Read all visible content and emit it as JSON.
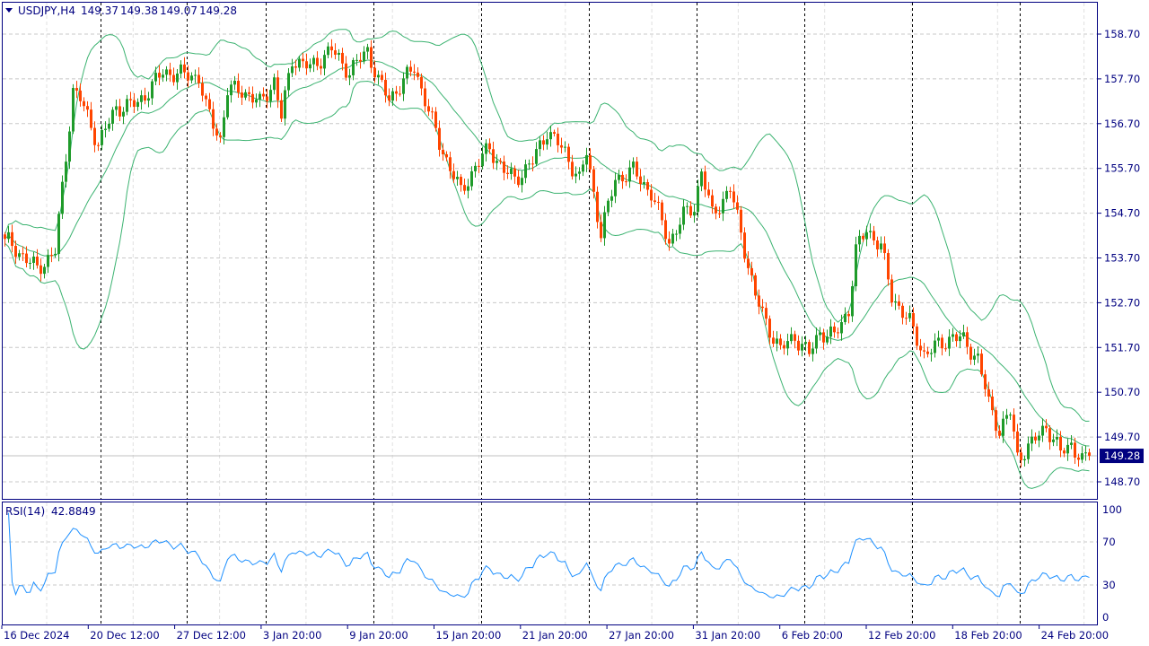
{
  "chart_data": {
    "type": "candlestick",
    "symbol_label": "USDJPY,H4",
    "header_ohlc": [
      "149.37",
      "149.38",
      "149.07",
      "149.28"
    ],
    "current_price": 149.28,
    "current_price_label": "149.28",
    "ylim": [
      148.34,
      159.42
    ],
    "yticks": [
      "158.70",
      "157.70",
      "156.70",
      "155.70",
      "154.70",
      "153.70",
      "152.70",
      "151.70",
      "150.70",
      "149.70",
      "148.70"
    ],
    "xticks": [
      "16 Dec 2024",
      "20 Dec 12:00",
      "27 Dec 12:00",
      "3 Jan 20:00",
      "9 Jan 20:00",
      "15 Jan 20:00",
      "21 Jan 20:00",
      "27 Jan 20:00",
      "31 Jan 20:00",
      "6 Feb 20:00",
      "12 Feb 20:00",
      "18 Feb 20:00",
      "24 Feb 20:00"
    ],
    "day_separators_bar_index": [
      27,
      51,
      73,
      103,
      133,
      163,
      193,
      223,
      253,
      283
    ],
    "key_closes": [
      [
        1,
        154.05
      ],
      [
        9,
        153.45
      ],
      [
        14,
        153.85
      ],
      [
        16,
        155.25
      ],
      [
        19,
        157.45
      ],
      [
        21,
        157.25
      ],
      [
        26,
        156.25
      ],
      [
        31,
        157.05
      ],
      [
        37,
        157.15
      ],
      [
        44,
        157.85
      ],
      [
        54,
        157.75
      ],
      [
        56,
        157.05
      ],
      [
        60,
        156.35
      ],
      [
        62,
        157.45
      ],
      [
        66,
        157.45
      ],
      [
        71,
        157.15
      ],
      [
        75,
        157.65
      ],
      [
        77,
        156.85
      ],
      [
        80,
        158.15
      ],
      [
        85,
        157.95
      ],
      [
        91,
        158.35
      ],
      [
        96,
        157.85
      ],
      [
        101,
        158.35
      ],
      [
        104,
        157.65
      ],
      [
        107,
        157.25
      ],
      [
        114,
        157.95
      ],
      [
        117,
        157.25
      ],
      [
        121,
        156.25
      ],
      [
        125,
        155.55
      ],
      [
        127,
        155.15
      ],
      [
        131,
        155.75
      ],
      [
        135,
        156.15
      ],
      [
        139,
        155.65
      ],
      [
        142,
        155.45
      ],
      [
        147,
        155.85
      ],
      [
        151,
        156.55
      ],
      [
        156,
        156.05
      ],
      [
        160,
        155.45
      ],
      [
        162,
        156.05
      ],
      [
        166,
        154.25
      ],
      [
        170,
        155.45
      ],
      [
        175,
        155.65
      ],
      [
        180,
        155.15
      ],
      [
        185,
        154.05
      ],
      [
        189,
        154.65
      ],
      [
        192,
        154.85
      ],
      [
        194,
        155.65
      ],
      [
        197,
        154.65
      ],
      [
        202,
        155.25
      ],
      [
        205,
        154.25
      ],
      [
        209,
        152.85
      ],
      [
        212,
        152.25
      ],
      [
        216,
        151.65
      ],
      [
        220,
        151.95
      ],
      [
        224,
        151.55
      ],
      [
        227,
        152.05
      ],
      [
        231,
        151.95
      ],
      [
        235,
        152.55
      ],
      [
        237,
        153.85
      ],
      [
        240,
        154.35
      ],
      [
        244,
        153.95
      ],
      [
        247,
        152.85
      ],
      [
        252,
        152.25
      ],
      [
        256,
        151.55
      ],
      [
        260,
        151.75
      ],
      [
        264,
        151.95
      ],
      [
        267,
        151.85
      ],
      [
        271,
        151.45
      ],
      [
        274,
        150.45
      ],
      [
        277,
        149.85
      ],
      [
        280,
        150.25
      ],
      [
        282,
        149.25
      ],
      [
        286,
        149.55
      ],
      [
        290,
        149.95
      ],
      [
        294,
        149.35
      ],
      [
        297,
        149.55
      ],
      [
        300,
        149.15
      ],
      [
        302,
        149.28
      ]
    ],
    "bollinger": {
      "period": 20,
      "deviation": 2,
      "color": "#3cb371"
    },
    "rsi": {
      "label": "RSI(14)",
      "value": "42.8849",
      "period": 14,
      "ylim": [
        0,
        100
      ],
      "ticks": [
        "100",
        "70",
        "30",
        "0"
      ],
      "color": "#1e90ff"
    },
    "colors": {
      "up": "#1f9b2a",
      "down": "#ff4500",
      "axis": "#000080",
      "grid": "#c8c8c8"
    }
  }
}
